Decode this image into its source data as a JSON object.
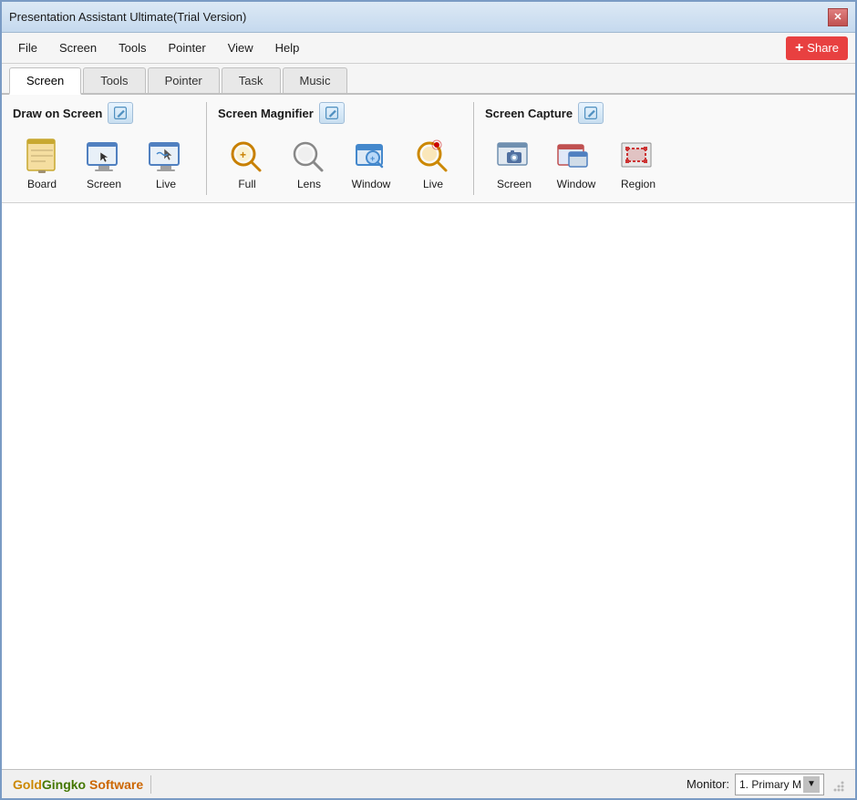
{
  "window": {
    "title": "Presentation Assistant Ultimate(Trial Version)"
  },
  "title_bar": {
    "title": "Presentation Assistant Ultimate(Trial Version)",
    "close_label": "✕"
  },
  "menu_bar": {
    "items": [
      {
        "label": "File"
      },
      {
        "label": "Screen"
      },
      {
        "label": "Tools"
      },
      {
        "label": "Pointer"
      },
      {
        "label": "View"
      },
      {
        "label": "Help"
      }
    ],
    "share_label": "Share"
  },
  "tabs": [
    {
      "label": "Screen",
      "active": true
    },
    {
      "label": "Tools"
    },
    {
      "label": "Pointer"
    },
    {
      "label": "Task"
    },
    {
      "label": "Music"
    }
  ],
  "toolbar": {
    "sections": [
      {
        "id": "draw-on-screen",
        "title": "Draw on Screen",
        "icons": [
          {
            "label": "Board",
            "icon": "board"
          },
          {
            "label": "Screen",
            "icon": "screen-draw"
          },
          {
            "label": "Live",
            "icon": "live-draw"
          }
        ]
      },
      {
        "id": "screen-magnifier",
        "title": "Screen Magnifier",
        "icons": [
          {
            "label": "Full",
            "icon": "magnifier-full"
          },
          {
            "label": "Lens",
            "icon": "magnifier-lens"
          },
          {
            "label": "Window",
            "icon": "magnifier-window"
          },
          {
            "label": "Live",
            "icon": "magnifier-live"
          }
        ]
      },
      {
        "id": "screen-capture",
        "title": "Screen Capture",
        "icons": [
          {
            "label": "Screen",
            "icon": "capture-screen"
          },
          {
            "label": "Window",
            "icon": "capture-window"
          },
          {
            "label": "Region",
            "icon": "capture-region"
          }
        ]
      }
    ]
  },
  "status_bar": {
    "brand": "GoldGingko Software",
    "monitor_label": "Monitor:",
    "monitor_value": "1. Primary M",
    "monitor_dropdown_arrow": "▼"
  }
}
